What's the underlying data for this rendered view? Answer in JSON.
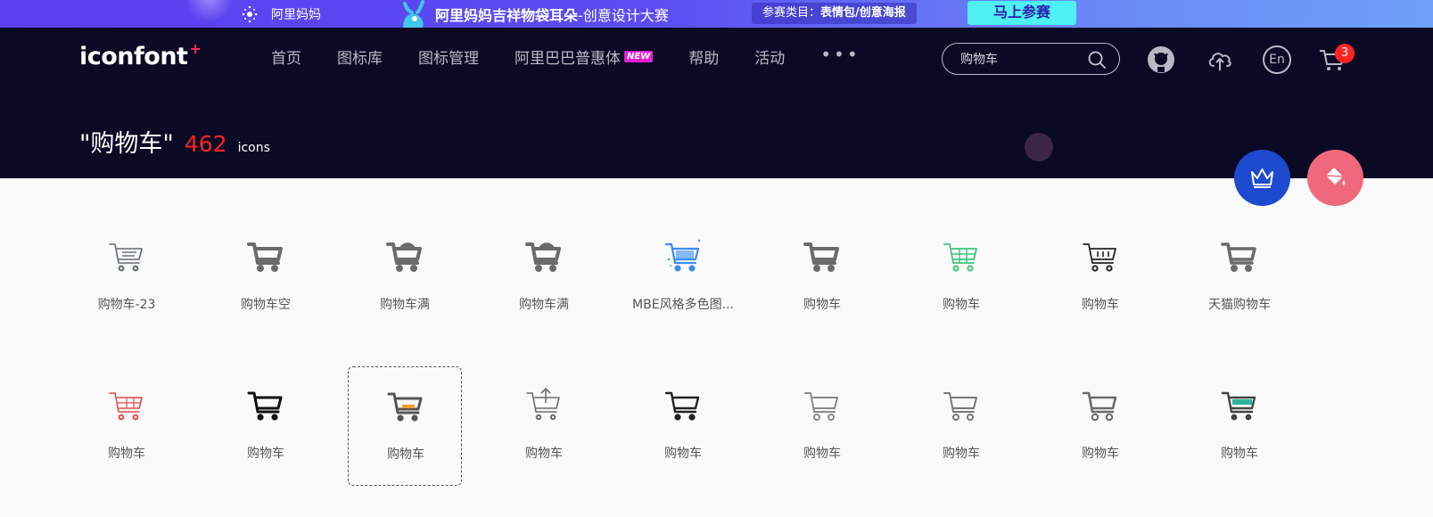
{
  "promo": {
    "brand": "阿里妈妈",
    "headline_bold": "阿里妈妈吉祥物袋耳朵",
    "headline_thin": "-创意设计大赛",
    "category_label": "参赛类目：",
    "category_value": "表情包/创意海报",
    "join_button": "马上参赛",
    "colors": {
      "gradient_start": "#5b3ff0",
      "gradient_end": "#6fa0f8",
      "button": "#4ff0f2"
    }
  },
  "header": {
    "logo": "iconfont",
    "logo_plus": "+",
    "nav": [
      {
        "label": "首页"
      },
      {
        "label": "图标库"
      },
      {
        "label": "图标管理"
      },
      {
        "label": "阿里巴巴普惠体",
        "badge": "NEW"
      },
      {
        "label": "帮助"
      },
      {
        "label": "活动"
      }
    ],
    "more": "•••",
    "search": {
      "value": "购物车",
      "placeholder": ""
    },
    "icons": [
      "github-icon",
      "upload-cloud-icon",
      "language-en-icon",
      "cart-icon"
    ],
    "lang": "En",
    "cart_count": "3"
  },
  "results": {
    "query": "\"购物车\"",
    "count": "462",
    "unit": "icons"
  },
  "fabs": [
    "crown-icon",
    "paint-bucket-icon"
  ],
  "icons": [
    {
      "label": "购物车-23",
      "style": "outline-list",
      "color": "#5e6b73"
    },
    {
      "label": "购物车空",
      "style": "bold-empty",
      "color": "#6b6b6b"
    },
    {
      "label": "购物车满",
      "style": "bold-full",
      "color": "#6b6b6b"
    },
    {
      "label": "购物车满",
      "style": "bold-full",
      "color": "#6b6b6b"
    },
    {
      "label": "MBE风格多色图...",
      "style": "mbe",
      "color": "#3a8ef6"
    },
    {
      "label": "购物车",
      "style": "bold",
      "color": "#6b6b6b"
    },
    {
      "label": "购物车",
      "style": "grid",
      "color": "#3fc47a"
    },
    {
      "label": "购物车",
      "style": "outline-basket",
      "color": "#222222"
    },
    {
      "label": "天猫购物车",
      "style": "tmall",
      "color": "#6b6b6b"
    },
    {
      "label": "购物车",
      "style": "red-grid",
      "color": "#e04b4b"
    },
    {
      "label": "购物车",
      "style": "bold-black",
      "color": "#111111"
    },
    {
      "label": "购物车",
      "style": "orange",
      "color": "#f0a030"
    },
    {
      "label": "购物车",
      "style": "arrow-up",
      "color": "#6b6b6b"
    },
    {
      "label": "购物车",
      "style": "thin-black",
      "color": "#222222"
    },
    {
      "label": "购物车",
      "style": "thin-grey",
      "color": "#888888"
    },
    {
      "label": "购物车",
      "style": "thin-grey",
      "color": "#777777"
    },
    {
      "label": "购物车",
      "style": "big-basket",
      "color": "#6b6b6b"
    },
    {
      "label": "购物车",
      "style": "teal",
      "color": "#2fb39a"
    }
  ],
  "selected_index": 11
}
